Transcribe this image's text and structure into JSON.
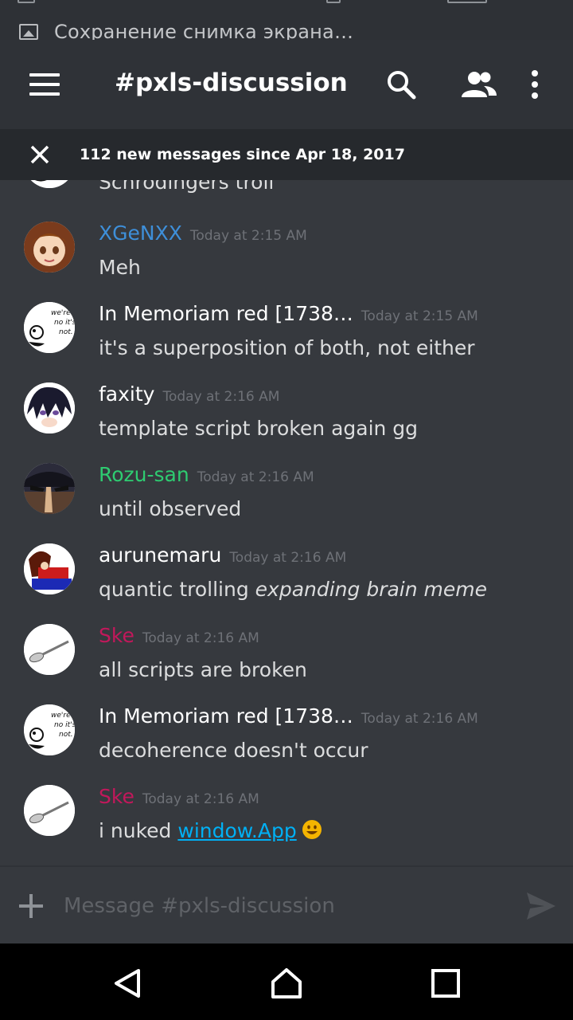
{
  "notification": {
    "text": "Сохранение снимка экрана…",
    "icon": "image-icon"
  },
  "header": {
    "channel": "#pxls-discussion"
  },
  "banner": {
    "text": "112 new messages since Apr 18, 2017"
  },
  "partial_message": {
    "text": "Schrödingers troll"
  },
  "messages": [
    {
      "user": "XGeNXX",
      "color": "#3e8fd9",
      "time": "Today at 2:15 AM",
      "text": "Meh"
    },
    {
      "user": "In Memoriam red [1738…",
      "color": "#ffffff",
      "time": "Today at 2:15 AM",
      "text": "it's a superposition of both, not either"
    },
    {
      "user": "faxity",
      "color": "#ffffff",
      "time": "Today at 2:16 AM",
      "text": "template script broken again gg"
    },
    {
      "user": "Rozu-san",
      "color": "#2ecc71",
      "time": "Today at 2:16 AM",
      "text": "until observed"
    },
    {
      "user": "aurunemaru",
      "color": "#ffffff",
      "time": "Today at 2:16 AM",
      "text": "quantic trolling ",
      "text_italic": "expanding brain meme"
    },
    {
      "user": "Ske",
      "color": "#c2185b",
      "time": "Today at 2:16 AM",
      "text": "all scripts are broken"
    },
    {
      "user": "In Memoriam red [1738…",
      "color": "#ffffff",
      "time": "Today at 2:16 AM",
      "text": "decoherence doesn't occur"
    },
    {
      "user": "Ske",
      "color": "#c2185b",
      "time": "Today at 2:16 AM",
      "text": "i nuked ",
      "link": "window.App",
      "emoji": "grinning-face-emoji"
    }
  ],
  "composer": {
    "placeholder": "Message #pxls-discussion"
  },
  "colors": {
    "background": "#36393e",
    "appbar": "#2f3237",
    "banner": "#26292d",
    "link": "#00b0f4"
  }
}
